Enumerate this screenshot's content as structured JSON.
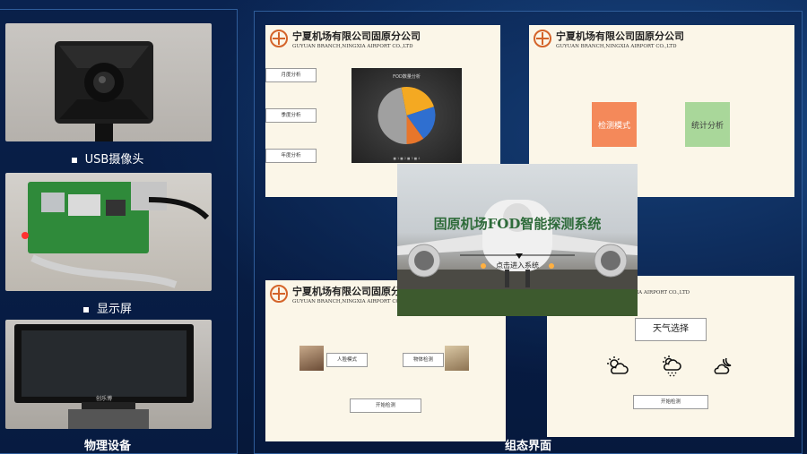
{
  "left_panel": {
    "camera_caption": "USB摄像头",
    "display_caption": "显示屏",
    "device_caption": "物理设备",
    "device_brand": "创乐博"
  },
  "screens": {
    "company_cn": "宁夏机场有限公司固原分公司",
    "company_en": "GUYUAN BRANCH,NINGXIA AIRPORT CO.,LTD",
    "company_en_partial": "IA AIRPORT CO.,LTD",
    "analysis": {
      "buttons": [
        "月度分析",
        "季度分析",
        "年度分析"
      ],
      "chart_title": "FOD数量分析",
      "chart_footer": "■ 1 ■ 2 ■ 3 ■ 4"
    },
    "mode": {
      "detect_label": "检测模式",
      "stats_label": "统计分析"
    },
    "splash": {
      "title": "固原机场FOD智能探测系统",
      "enter_label": "点击进入系统"
    },
    "detect": {
      "person_mode": "人脸模式",
      "object_mode": "物体检测",
      "start_label": "开始检测"
    },
    "weather": {
      "title": "天气选择",
      "start_label": "开始检测",
      "icons": [
        "partly-cloudy-icon",
        "snow-icon",
        "cloudy-night-icon"
      ]
    },
    "section_caption": "组态界面"
  },
  "chart_data": {
    "type": "pie",
    "title": "FOD数量分析",
    "categories": [
      "1",
      "2",
      "3",
      "4"
    ],
    "values": [
      47,
      23,
      20,
      10
    ],
    "colors": [
      "#a0a0a0",
      "#f4a922",
      "#2f6fd0",
      "#e8762b"
    ]
  }
}
